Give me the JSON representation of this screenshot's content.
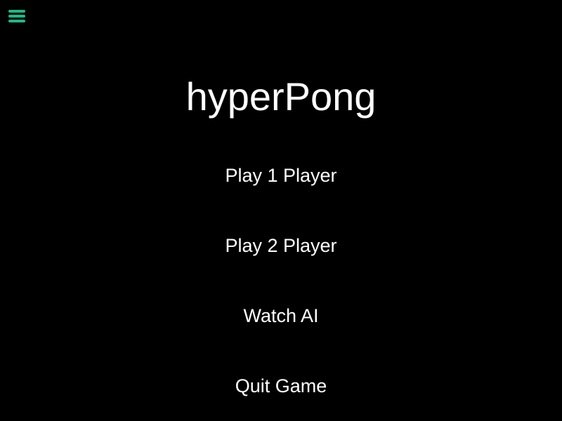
{
  "app": {
    "title": "hyperPong",
    "menu_icon": "hamburger-menu-icon",
    "accent_color": "#1db887"
  },
  "menu": {
    "items": [
      {
        "label": "Play 1 Player"
      },
      {
        "label": "Play 2 Player"
      },
      {
        "label": "Watch AI"
      },
      {
        "label": "Quit Game"
      }
    ]
  }
}
